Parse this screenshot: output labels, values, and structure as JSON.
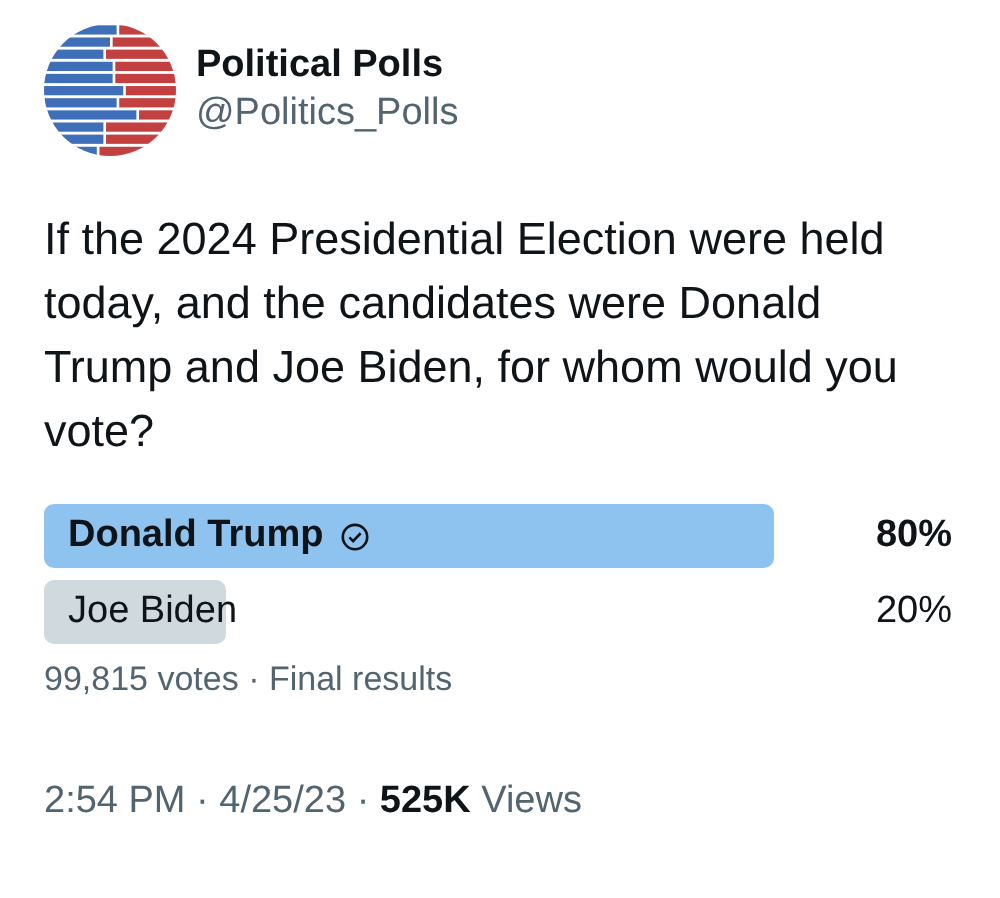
{
  "author": {
    "name": "Political Polls",
    "handle": "@Politics_Polls"
  },
  "text": "If the 2024 Presidential Election were held today, and the candidates were Donald Trump and Joe Biden, for whom would you vote?",
  "poll": {
    "options": [
      {
        "label": "Donald Trump",
        "percent": "80%",
        "winner": true
      },
      {
        "label": "Joe Biden",
        "percent": "20%",
        "winner": false
      }
    ],
    "summary": "99,815 votes · Final results"
  },
  "meta": {
    "time": "2:54 PM · 4/25/23 · ",
    "views_count": "525K",
    "views_label": " Views"
  }
}
